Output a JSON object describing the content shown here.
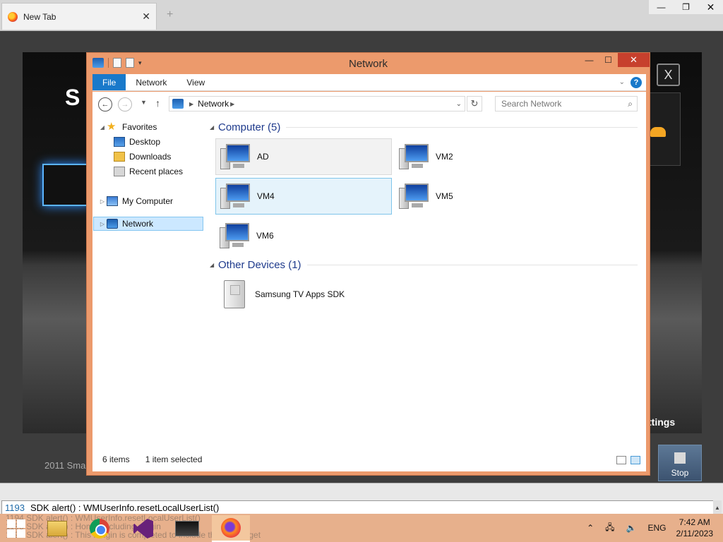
{
  "browser": {
    "tab_title": "New Tab",
    "tab_close": "✕",
    "new_tab": "+",
    "controls": {
      "minimize": "—",
      "maximize": "❐",
      "close": "✕"
    }
  },
  "emulator": {
    "logo_partial": "S",
    "close_label": "X",
    "settings_partial": "ttings",
    "footer_partial": "2011 Sma",
    "stop_label": "Stop"
  },
  "explorer": {
    "title": "Network",
    "controls": {
      "minimize": "—",
      "maximize": "☐",
      "close": "✕"
    },
    "ribbon": {
      "tabs": [
        "File",
        "Network",
        "View"
      ]
    },
    "address": {
      "path": "Network"
    },
    "search": {
      "placeholder": "Search Network"
    },
    "nav_pane": {
      "favorites": "Favorites",
      "favorite_items": [
        "Desktop",
        "Downloads",
        "Recent places"
      ],
      "my_computer": "My Computer",
      "network": "Network"
    },
    "groups": [
      {
        "title": "Computer (5)",
        "items": [
          "AD",
          "VM2",
          "VM4",
          "VM5",
          "VM6"
        ]
      },
      {
        "title": "Other Devices (1)",
        "items": [
          "Samsung TV Apps SDK"
        ]
      }
    ],
    "status": {
      "count": "6 items",
      "selection": "1 item selected"
    }
  },
  "console": {
    "line_number": "1193",
    "message": "SDK alert() : WMUserInfo.resetLocalUserList()"
  },
  "taskbar": {
    "ghost_lines": [
      "1194  SDK alert() : WMUserInfo.resetLocalUserList()",
      "1195  SDK alert() : Home: including plugin",
      "1196  SDK alert() : This Plugin is completed to include the ExtWidget"
    ],
    "apps": [
      "file-explorer",
      "chrome",
      "visual-studio",
      "emulator",
      "firefox"
    ],
    "language": "ENG",
    "time": "7:42 AM",
    "date": "2/11/2023"
  },
  "colors": {
    "window_frame": "#ec9a6c",
    "accent_blue": "#1979ca",
    "taskbar": "#e7b08c",
    "group_title": "#1e3a8c"
  }
}
